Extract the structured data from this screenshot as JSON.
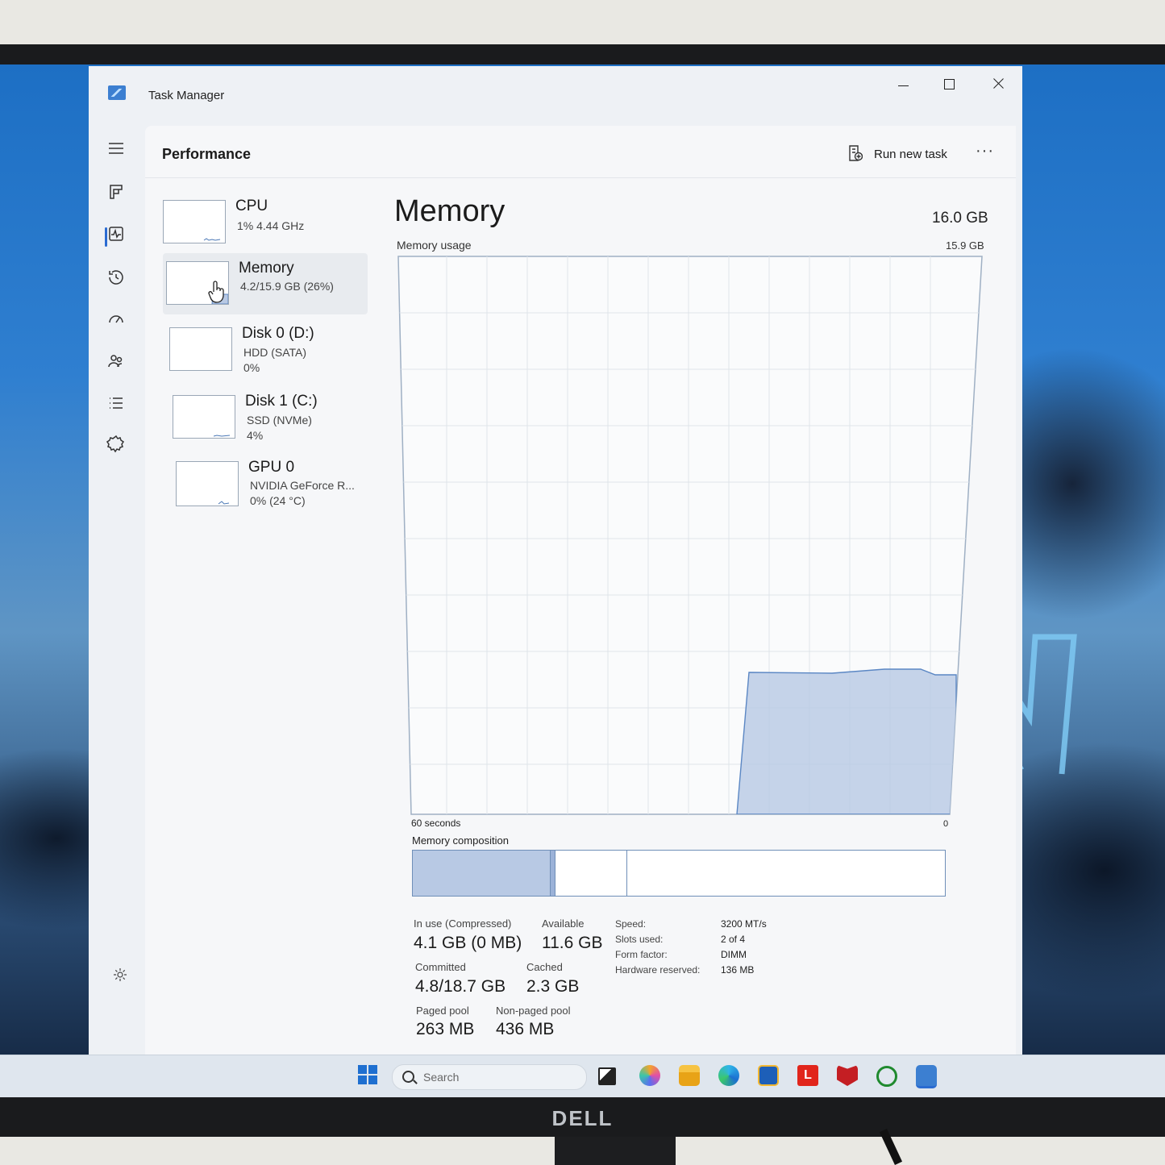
{
  "window": {
    "title": "Task Manager"
  },
  "header": {
    "page_title": "Performance",
    "run_new_task": "Run new task",
    "more": "···"
  },
  "nav": [
    "hamburger-icon",
    "processes-icon",
    "performance-icon",
    "app-history-icon",
    "startup-apps-icon",
    "users-icon",
    "details-icon",
    "services-icon"
  ],
  "devices": [
    {
      "name": "CPU",
      "lines": [
        "1% 4.44 GHz"
      ]
    },
    {
      "name": "Memory",
      "lines": [
        "4.2/15.9 GB (26%)"
      ]
    },
    {
      "name": "Disk 0 (D:)",
      "lines": [
        "HDD (SATA)",
        "0%"
      ]
    },
    {
      "name": "Disk 1 (C:)",
      "lines": [
        "SSD (NVMe)",
        "4%"
      ]
    },
    {
      "name": "GPU 0",
      "lines": [
        "NVIDIA GeForce R...",
        "0% (24 °C)"
      ]
    }
  ],
  "detail": {
    "title": "Memory",
    "total": "16.0 GB",
    "usage_label": "Memory usage",
    "usage_max": "15.9 GB",
    "axis_left": "60 seconds",
    "axis_right": "0",
    "composition_label": "Memory composition",
    "composition": {
      "in_use_fraction": 0.26,
      "modified_fraction": 0.008,
      "standby_fraction": 0.133
    },
    "stats": {
      "in_use_label": "In use (Compressed)",
      "in_use": "4.1 GB (0 MB)",
      "available_label": "Available",
      "available": "11.6 GB",
      "committed_label": "Committed",
      "committed": "4.8/18.7 GB",
      "cached_label": "Cached",
      "cached": "2.3 GB",
      "paged_label": "Paged pool",
      "paged": "263 MB",
      "nonpaged_label": "Non-paged pool",
      "nonpaged": "436 MB"
    },
    "specs": [
      {
        "label": "Speed:",
        "value": "3200 MT/s"
      },
      {
        "label": "Slots used:",
        "value": "2 of 4"
      },
      {
        "label": "Form factor:",
        "value": "DIMM"
      },
      {
        "label": "Hardware reserved:",
        "value": "136 MB"
      }
    ]
  },
  "taskbar": {
    "search_placeholder": "Search",
    "apps": [
      "task-view-icon",
      "copilot-icon",
      "file-explorer-icon",
      "edge-icon",
      "store-icon",
      "lenovo-icon",
      "mcafee-icon",
      "xbox-icon",
      "task-manager-icon"
    ]
  },
  "monitor": {
    "brand": "DELL"
  },
  "colors": {
    "accent": "#2a6bd1",
    "graph_fill": "#b8c9e4",
    "graph_line": "#5b87c4"
  }
}
